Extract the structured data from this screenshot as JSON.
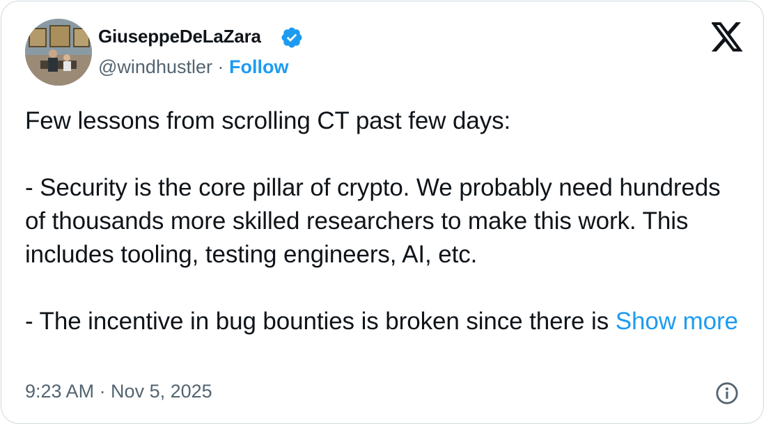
{
  "author": {
    "display_name": "GiuseppeDeLaZara",
    "handle": "@windhustler",
    "separator": "·",
    "follow_label": "Follow",
    "verified": true,
    "avatar_icon": "profile-photo"
  },
  "brand": {
    "logo_icon": "x-logo-icon",
    "accent_color": "#1d9bf0",
    "verified_color": "#1d9bf0"
  },
  "tweet": {
    "body": "Few lessons from scrolling CT past few days:\n\n- Security is the core pillar of crypto. We probably need hundreds of thousands more skilled researchers to make this work. This includes tooling, testing engineers, AI, etc.\n\n- The incentive in bug bounties is broken since there is ",
    "show_more_label": "Show more",
    "timestamp": "9:23 AM · Nov 5, 2025"
  },
  "footer": {
    "info_icon": "info-icon"
  }
}
